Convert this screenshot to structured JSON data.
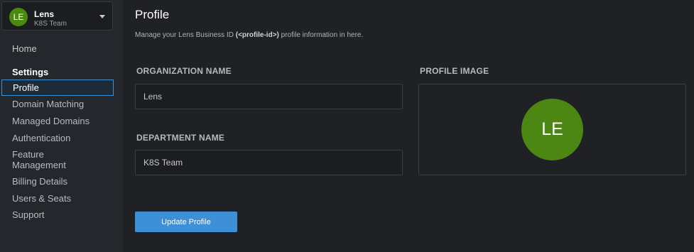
{
  "org": {
    "avatar_initials": "LE",
    "name": "Lens",
    "team": "K8S Team"
  },
  "sidebar": {
    "home": "Home",
    "section_title": "Settings",
    "items": [
      {
        "label": "Profile",
        "active": true
      },
      {
        "label": "Domain Matching"
      },
      {
        "label": "Managed Domains"
      },
      {
        "label": "Authentication"
      },
      {
        "label": "Feature Management"
      },
      {
        "label": "Billing Details"
      },
      {
        "label": "Users & Seats"
      },
      {
        "label": "Support"
      }
    ]
  },
  "main": {
    "title": "Profile",
    "subtitle_prefix": "Manage your Lens Business ID ",
    "subtitle_id": "(<profile-id>)",
    "subtitle_suffix": " profile information in here.",
    "org_name_label": "ORGANIZATION NAME",
    "org_name_value": "Lens",
    "dept_name_label": "DEPARTMENT NAME",
    "dept_name_value": "K8S Team",
    "profile_image_label": "PROFILE IMAGE",
    "profile_avatar_initials": "LE",
    "update_button": "Update Profile"
  },
  "colors": {
    "accent": "#3d8fd6",
    "avatar": "#4b8712",
    "background": "#1f2125",
    "sidebar": "#24272b"
  }
}
